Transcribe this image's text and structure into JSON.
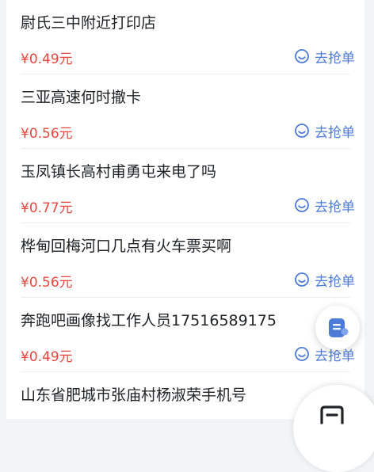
{
  "orders": [
    {
      "title": "尉氏三中附近打印店",
      "price": "¥0.49元",
      "action": "去抢单"
    },
    {
      "title": "三亚高速何时撤卡",
      "price": "¥0.56元",
      "action": "去抢单"
    },
    {
      "title": "玉凤镇长高村甫勇屯来电了吗",
      "price": "¥0.77元",
      "action": "去抢单"
    },
    {
      "title": "桦甸回梅河口几点有火车票买啊",
      "price": "¥0.56元",
      "action": "去抢单"
    },
    {
      "title": "奔跑吧画像找工作人员17516589175",
      "price": "¥0.49元",
      "action": "去抢单"
    },
    {
      "title": "山东省肥城市张庙村杨淑荣手机号",
      "price": "",
      "action": ""
    }
  ],
  "colors": {
    "price": "#e5473d",
    "action": "#4d7bd8",
    "fab_icon": "#4d7bd8"
  },
  "icons": {
    "action": "smile-circle-icon",
    "fab": "note-icon",
    "corner": "clipboard-icon"
  }
}
